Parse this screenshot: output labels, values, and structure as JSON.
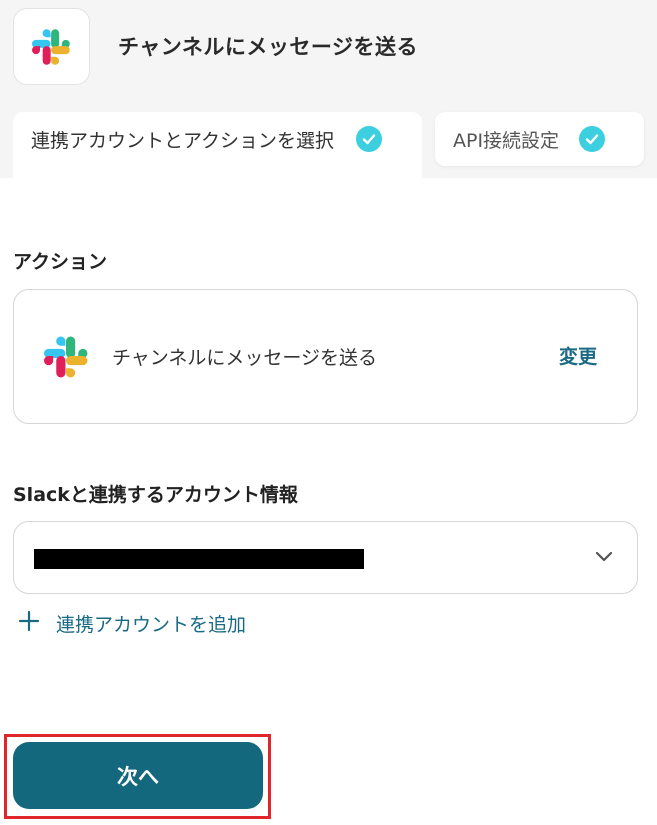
{
  "header": {
    "app_icon": "slack-logo-icon",
    "title": "チャンネルにメッセージを送る"
  },
  "tabs": [
    {
      "label": "連携アカウントとアクションを選択",
      "completed": true,
      "active": true
    },
    {
      "label": "API接続設定",
      "completed": true,
      "active": false
    }
  ],
  "action_section": {
    "label": "アクション",
    "action_icon": "slack-logo-icon",
    "action_name": "チャンネルにメッセージを送る",
    "change_label": "変更"
  },
  "account_section": {
    "label": "Slackと連携するアカウント情報",
    "selected_value_redacted": true,
    "dropdown_icon": "chevron-down-icon",
    "add_account_label": "連携アカウントを追加"
  },
  "footer": {
    "next_label": "次へ"
  },
  "colors": {
    "accent": "#14687e",
    "link": "#1b6a83",
    "check": "#3ccfe0",
    "highlight": "#e0252b",
    "slack_blue": "#36c5f0",
    "slack_green": "#2eb67d",
    "slack_yellow": "#ecb22e",
    "slack_red": "#e01e5a"
  }
}
